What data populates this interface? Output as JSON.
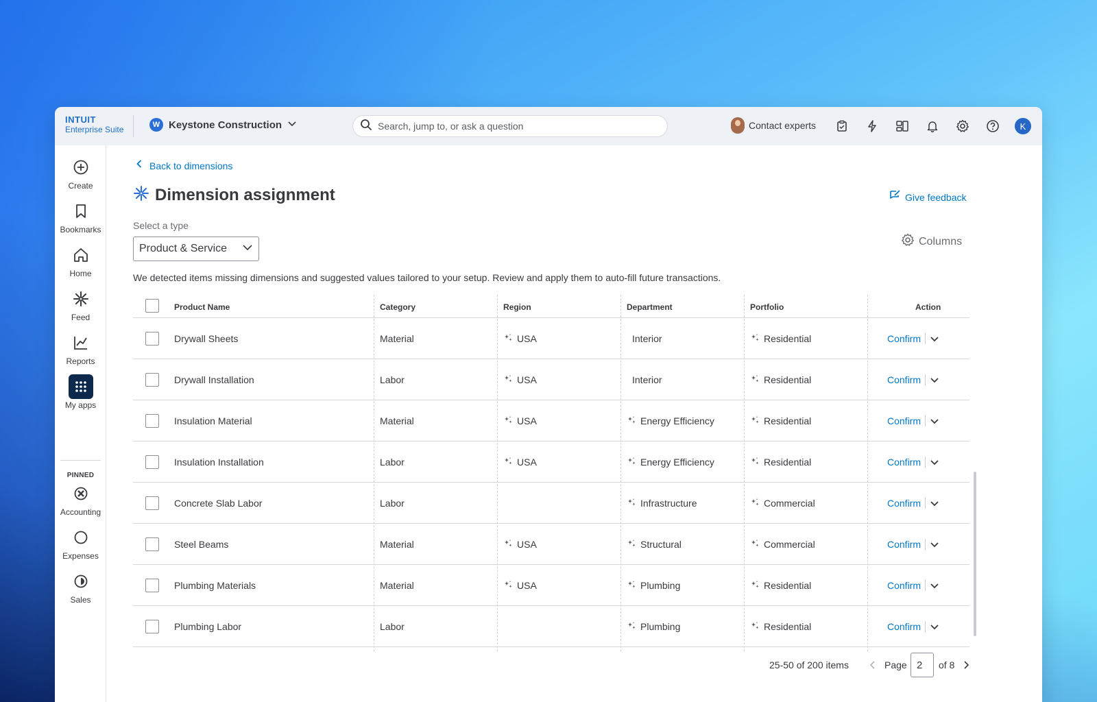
{
  "brand": {
    "top": "INTUIT",
    "bottom": "Enterprise Suite"
  },
  "company": {
    "initial": "W",
    "name": "Keystone Construction"
  },
  "search": {
    "placeholder": "Search, jump to, or ask a question"
  },
  "topbar": {
    "contact_label": "Contact experts",
    "icons": [
      "clipboard-icon",
      "lightning-icon",
      "apps-icon",
      "bell-icon",
      "gear-icon",
      "help-icon"
    ],
    "user_initial": "K"
  },
  "sidebar": {
    "items": [
      {
        "label": "Create",
        "icon": "plus-circle-icon"
      },
      {
        "label": "Bookmarks",
        "icon": "bookmark-icon"
      },
      {
        "label": "Home",
        "icon": "home-icon"
      },
      {
        "label": "Feed",
        "icon": "sparkle-icon"
      },
      {
        "label": "Reports",
        "icon": "chart-icon"
      },
      {
        "label": "My apps",
        "icon": "grid-icon"
      }
    ],
    "pinned_label": "PINNED",
    "pinned": [
      {
        "label": "Accounting",
        "icon": "accounting-icon"
      },
      {
        "label": "Expenses",
        "icon": "expenses-icon"
      },
      {
        "label": "Sales",
        "icon": "sales-icon"
      }
    ]
  },
  "page": {
    "back_label": "Back to dimensions",
    "title": "Dimension assignment",
    "feedback_label": "Give feedback",
    "type_label": "Select a type",
    "type_value": "Product & Service",
    "columns_label": "Columns",
    "description": "We detected items missing dimensions and suggested values tailored to your setup. Review and apply them to auto-fill future transactions."
  },
  "table": {
    "headers": {
      "name": "Product Name",
      "category": "Category",
      "region": "Region",
      "department": "Department",
      "portfolio": "Portfolio",
      "action": "Action"
    },
    "action_label": "Confirm",
    "rows": [
      {
        "name": "Drywall Sheets",
        "category": "Material",
        "region": "USA",
        "region_ai": true,
        "department": "Interior",
        "department_ai": false,
        "portfolio": "Residential",
        "portfolio_ai": true
      },
      {
        "name": "Drywall Installation",
        "category": "Labor",
        "region": "USA",
        "region_ai": true,
        "department": "Interior",
        "department_ai": false,
        "portfolio": "Residential",
        "portfolio_ai": true
      },
      {
        "name": "Insulation Material",
        "category": "Material",
        "region": "USA",
        "region_ai": true,
        "department": "Energy Efficiency",
        "department_ai": true,
        "portfolio": "Residential",
        "portfolio_ai": true
      },
      {
        "name": "Insulation Installation",
        "category": "Labor",
        "region": "USA",
        "region_ai": true,
        "department": "Energy Efficiency",
        "department_ai": true,
        "portfolio": "Residential",
        "portfolio_ai": true
      },
      {
        "name": "Concrete Slab Labor",
        "category": "Labor",
        "region": "",
        "region_ai": false,
        "department": "Infrastructure",
        "department_ai": true,
        "portfolio": "Commercial",
        "portfolio_ai": true
      },
      {
        "name": "Steel Beams",
        "category": "Material",
        "region": "USA",
        "region_ai": true,
        "department": "Structural",
        "department_ai": true,
        "portfolio": "Commercial",
        "portfolio_ai": true
      },
      {
        "name": "Plumbing Materials",
        "category": "Material",
        "region": "USA",
        "region_ai": true,
        "department": "Plumbing",
        "department_ai": true,
        "portfolio": "Residential",
        "portfolio_ai": true
      },
      {
        "name": "Plumbing Labor",
        "category": "Labor",
        "region": "",
        "region_ai": false,
        "department": "Plumbing",
        "department_ai": true,
        "portfolio": "Residential",
        "portfolio_ai": true
      }
    ]
  },
  "pagination": {
    "range": "25-50 of 200 items",
    "page_word": "Page",
    "current": "2",
    "of_total": "of 8"
  },
  "colors": {
    "accent": "#0077c5",
    "active_nav": "#0d2a4e",
    "avatar": "#2566c6"
  }
}
